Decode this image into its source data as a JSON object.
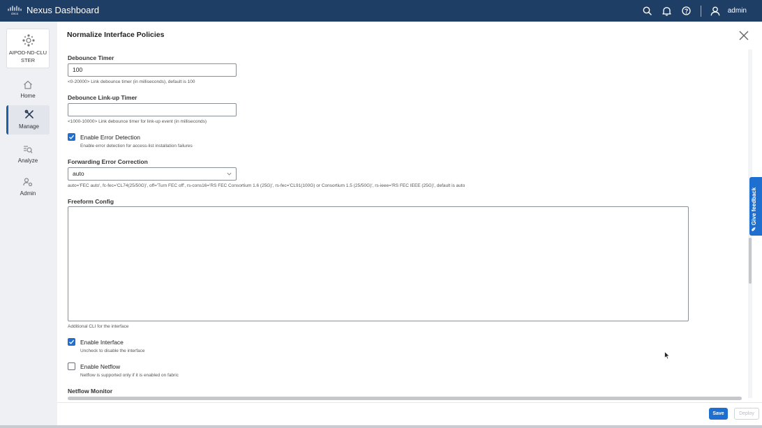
{
  "header": {
    "logo_text": "cisco",
    "app_title": "Nexus Dashboard",
    "user": "admin"
  },
  "sidebar": {
    "cluster_label": "AIPOD-ND-CLUSTER",
    "items": [
      {
        "label": "Home",
        "icon": "home-icon",
        "active": false
      },
      {
        "label": "Manage",
        "icon": "tools-icon",
        "active": true
      },
      {
        "label": "Analyze",
        "icon": "analyze-icon",
        "active": false
      },
      {
        "label": "Admin",
        "icon": "admin-icon",
        "active": false
      }
    ]
  },
  "panel": {
    "title": "Normalize Interface Policies",
    "debounce_timer": {
      "label": "Debounce Timer",
      "value": "100",
      "help": "<0-20000> Link debounce timer (in milliseconds), default is 100"
    },
    "debounce_linkup": {
      "label": "Debounce Link-up Timer",
      "value": "",
      "help": "<1000-10000> Link debounce timer for link-up event (in milliseconds)"
    },
    "error_detection": {
      "label": "Enable Error Detection",
      "checked": true,
      "help": "Enable error detection for access-list installation failures"
    },
    "fec": {
      "label": "Forwarding Error Correction",
      "value": "auto",
      "help": "auto='FEC auto', fc-fec='CL74(25/50G)', off='Turn FEC off', rs-cons16='RS FEC Consortium 1.6 (25G)', rs-fec='CL91(100G) or Consortium 1.5 (25/50G)', rs-ieee='RS FEC IEEE (25G)', default is auto"
    },
    "freeform": {
      "label": "Freeform Config",
      "value": "",
      "help": "Additional CLI for the interface"
    },
    "enable_interface": {
      "label": "Enable Interface",
      "checked": true,
      "help": "Uncheck to disable the interface"
    },
    "enable_netflow": {
      "label": "Enable Netflow",
      "checked": false,
      "help": "Netflow is supported only if it is enabled on fabric"
    },
    "netflow_monitor": {
      "label": "Netflow Monitor"
    }
  },
  "footer": {
    "save_label": "Save",
    "deploy_label": "Deploy"
  },
  "feedback_label": "Give feedback",
  "colors": {
    "header_bg": "#1f3e66",
    "accent": "#1f6fd0",
    "sidebar_bg": "#eef0f3"
  }
}
